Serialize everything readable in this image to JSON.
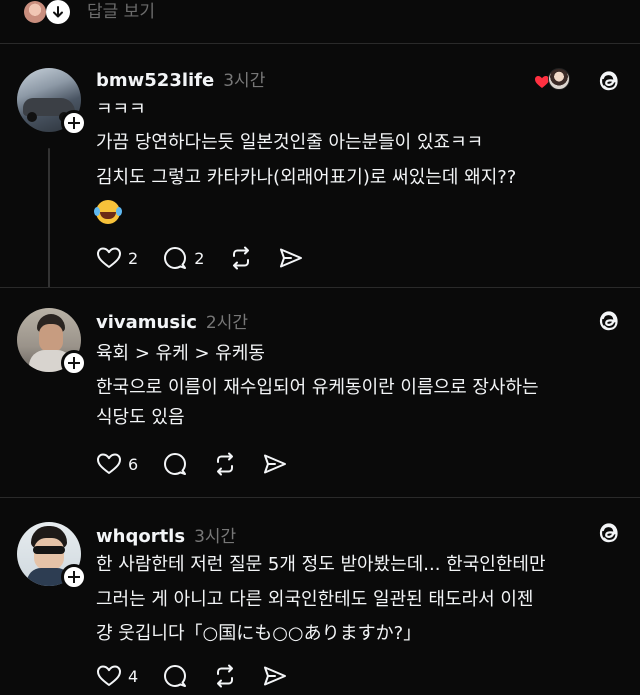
{
  "replies_bar": {
    "label": "답글 보기"
  },
  "posts": [
    {
      "username": "bmw523life",
      "time": "3시간",
      "lines": [
        "ㅋㅋㅋ",
        "가끔 당연하다는듯 일본것인줄 아는분들이 있죠ㅋㅋ",
        "김치도 그렇고 카타카나(외래어표기)로 써있는데 왜지??"
      ],
      "emoji": "face-with-tears-of-joy",
      "likes": "2",
      "replies": "2"
    },
    {
      "username": "vivamusic",
      "time": "2시간",
      "lines": [
        "육회 > 유케 > 유케동",
        "한국으로 이름이 재수입되어 유케동이란 이름으로 장사하는",
        "식당도 있음"
      ],
      "likes": "6"
    },
    {
      "username": "whqortls",
      "time": "3시간",
      "lines": [
        "한 사람한테 저런 질문 5개 정도 받아봤는데... 한국인한테만",
        "그러는 게 아니고 다른 외국인한테도 일관된 태도라서 이젠",
        "걍 웃깁니다「○国にも○○ありますか?」"
      ],
      "likes": "4"
    }
  ],
  "colors": {
    "background": "#0a0a0a",
    "text": "#f3f5f7",
    "muted": "#777777",
    "heart": "#ff3040"
  }
}
